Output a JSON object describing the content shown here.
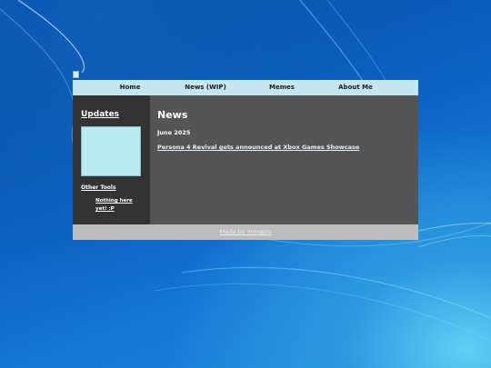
{
  "colors": {
    "navbar_bg": "#c4e6ef",
    "sidebar_bg": "#333333",
    "main_bg": "#555555",
    "footer_bg": "#bdbdbd",
    "updates_box_bg": "#b8ecf3"
  },
  "navbar": {
    "items": [
      {
        "label": "Home"
      },
      {
        "label": "News (WIP)"
      },
      {
        "label": "Memes"
      },
      {
        "label": "About Me"
      }
    ]
  },
  "sidebar": {
    "updates_heading": "Updates",
    "other_tools_heading": "Other Tools",
    "tools": [
      {
        "label": "Nothing here yet! :P"
      }
    ]
  },
  "main": {
    "title": "News",
    "sections": [
      {
        "date": "June 2025",
        "items": [
          {
            "label": "Persona 4 Revival gets announced at Xbox Games Showcase"
          }
        ]
      }
    ]
  },
  "footer": {
    "text": "Made by mmqpiu"
  }
}
